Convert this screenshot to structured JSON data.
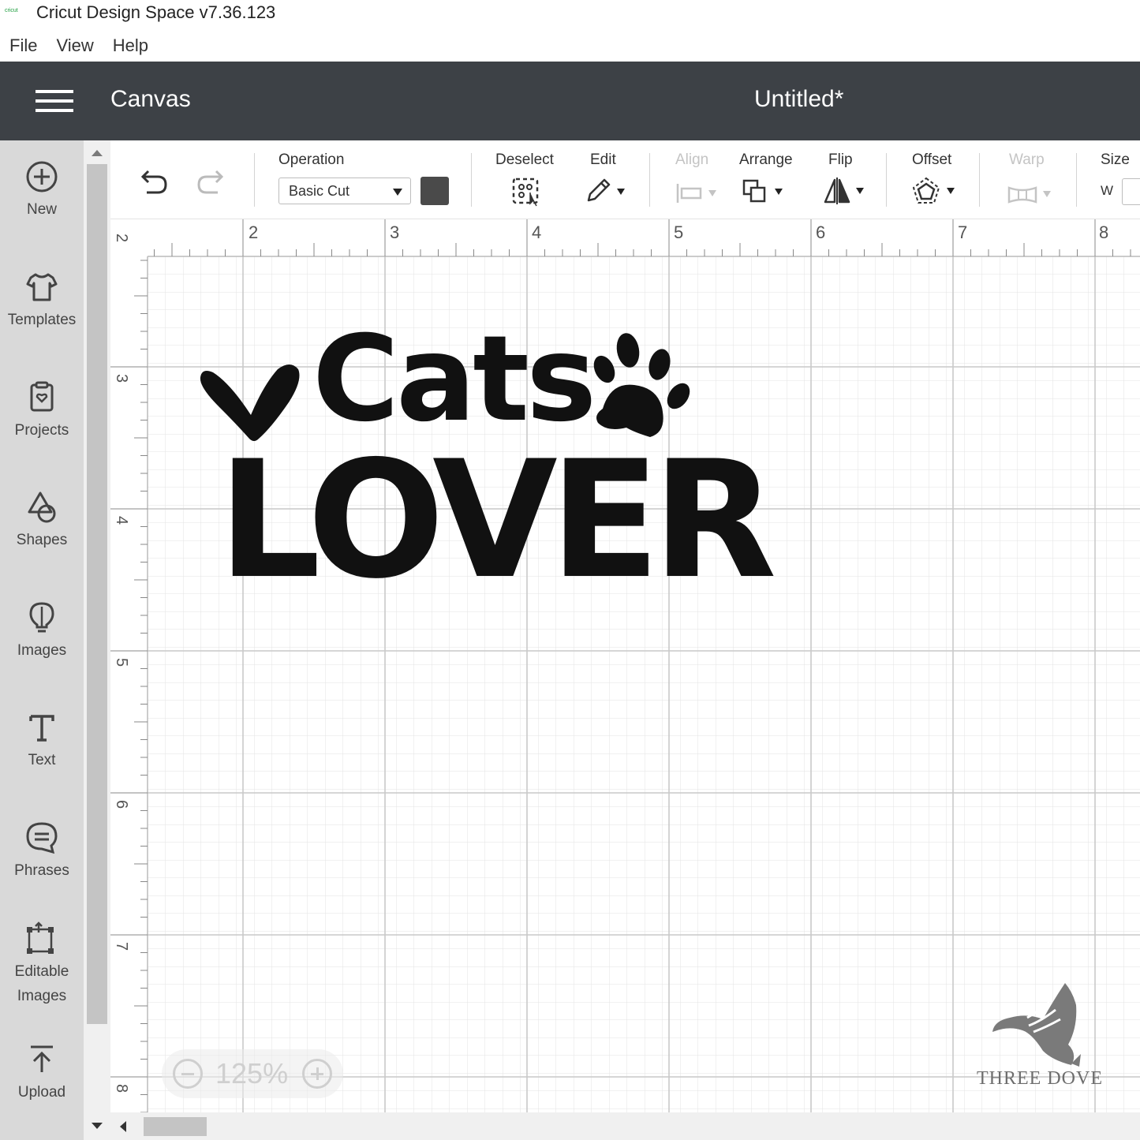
{
  "window": {
    "title": "Cricut Design Space  v7.36.123",
    "logo_text": "cricut"
  },
  "menubar": {
    "items": [
      "File",
      "View",
      "Help"
    ]
  },
  "header": {
    "section": "Canvas",
    "document_title": "Untitled*"
  },
  "sidebar": {
    "items": [
      {
        "label": "New",
        "icon": "plus-circle-icon"
      },
      {
        "label": "Templates",
        "icon": "tshirt-icon"
      },
      {
        "label": "Projects",
        "icon": "project-icon"
      },
      {
        "label": "Shapes",
        "icon": "shapes-icon"
      },
      {
        "label": "Images",
        "icon": "lightbulb-icon"
      },
      {
        "label": "Text",
        "icon": "text-icon"
      },
      {
        "label": "Phrases",
        "icon": "speech-bubble-icon"
      },
      {
        "label": "Editable",
        "label2": "Images",
        "icon": "editable-images-icon"
      },
      {
        "label": "Upload",
        "icon": "upload-icon"
      }
    ]
  },
  "toolbar": {
    "operation_label": "Operation",
    "operation_value": "Basic Cut",
    "operation_color": "#4a4a4a",
    "deselect_label": "Deselect",
    "edit_label": "Edit",
    "align_label": "Align",
    "arrange_label": "Arrange",
    "flip_label": "Flip",
    "offset_label": "Offset",
    "warp_label": "Warp",
    "size_label": "Size",
    "size_w_label": "W"
  },
  "rulers": {
    "horizontal": [
      "2",
      "3",
      "4",
      "5",
      "6",
      "7",
      "8"
    ],
    "vertical": [
      "2",
      "3",
      "4",
      "5",
      "6",
      "7",
      "8"
    ]
  },
  "design": {
    "line1": "Cats",
    "line2": "Lover",
    "color": "#111111"
  },
  "zoom": {
    "value": "125%"
  },
  "watermark": {
    "text": "THREE DOVE"
  }
}
